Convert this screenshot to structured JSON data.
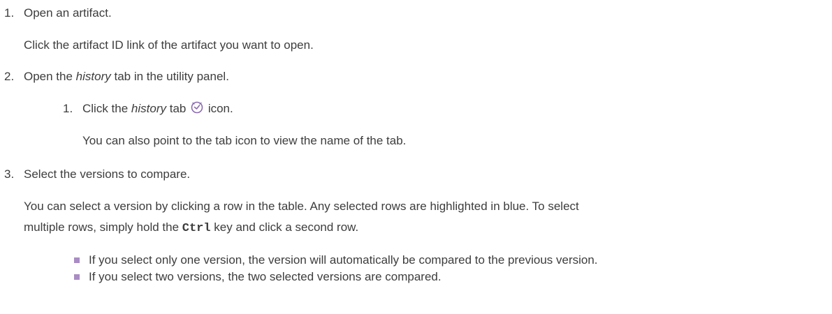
{
  "steps": [
    {
      "number": "1.",
      "title": "Open an artifact.",
      "detail": "Click the artifact ID link of the artifact you want to open."
    },
    {
      "number": "2.",
      "title_pre": "Open the ",
      "title_em": "history",
      "title_post": " tab in the utility panel.",
      "substeps": [
        {
          "number": "1.",
          "title_pre": "Click the ",
          "title_em": "history",
          "title_mid": " tab ",
          "icon": "clock-icon",
          "title_post": " icon.",
          "detail": "You can also point to the tab icon to view the name of the tab."
        }
      ]
    },
    {
      "number": "3.",
      "title": "Select the versions to compare.",
      "detail_line1": "You can select a version by clicking a row in the table. Any selected rows are highlighted in blue. To select",
      "detail_line2_pre": "multiple rows, simply hold the ",
      "detail_line2_code": "Ctrl",
      "detail_line2_post": " key and click a second row.",
      "bullets": [
        "If you select only one version, the version will automatically be compared to the previous version.",
        "If you select two versions, the two selected versions are compared."
      ]
    }
  ],
  "colors": {
    "text": "#3d3d3d",
    "bullet": "#a98cc4",
    "icon": "#8a6bb0"
  }
}
